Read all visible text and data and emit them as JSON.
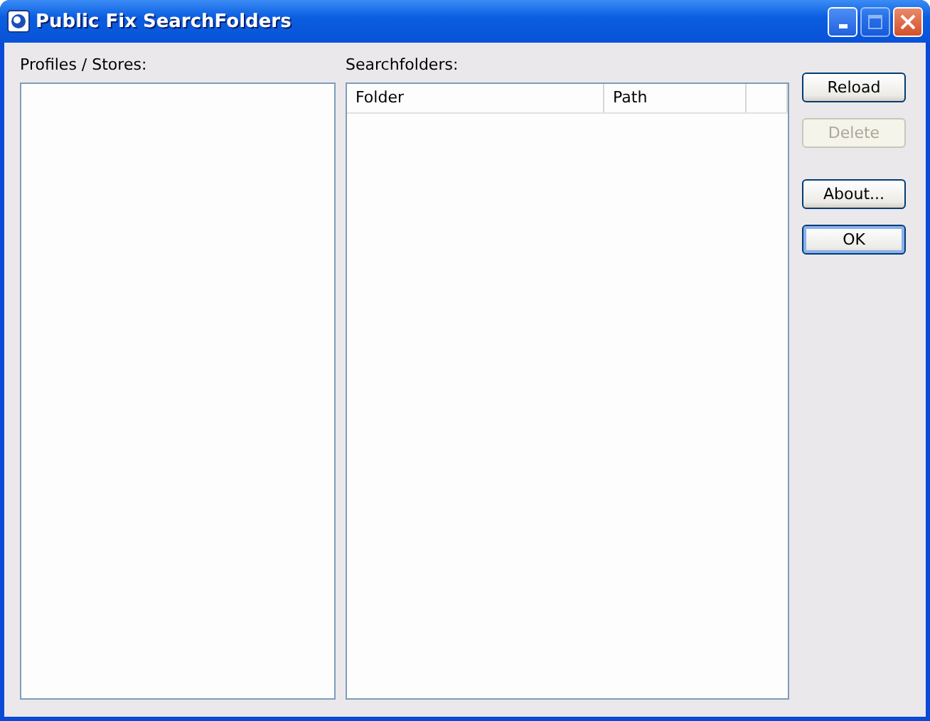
{
  "window": {
    "title": "Public Fix SearchFolders",
    "maximize_disabled": true
  },
  "profiles": {
    "label": "Profiles / Stores:"
  },
  "searchfolders": {
    "label": "Searchfolders:",
    "columns": [
      "Folder",
      "Path"
    ]
  },
  "buttons": [
    {
      "label": "Reload",
      "disabled": false,
      "default": false
    },
    {
      "label": "Delete",
      "disabled": true,
      "default": false
    },
    {
      "label": "About...",
      "disabled": false,
      "default": false
    },
    {
      "label": "OK",
      "disabled": false,
      "default": true
    }
  ]
}
